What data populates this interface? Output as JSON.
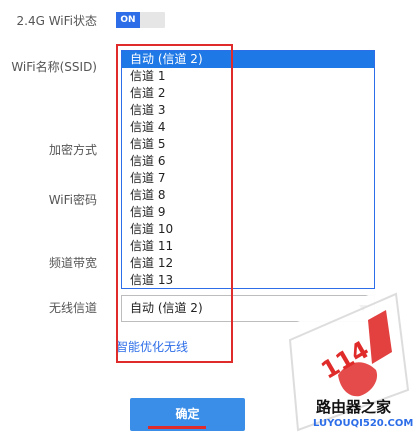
{
  "settings": {
    "wifi_status_label": "2.4G WiFi状态",
    "wifi_status_value": "ON",
    "ssid_label": "WiFi名称(SSID)",
    "encryption_label": "加密方式",
    "password_label": "WiFi密码",
    "bandwidth_label": "频道带宽",
    "channel_label": "无线信道"
  },
  "channel_dropdown": {
    "options": [
      "自动 (信道 2)",
      "信道 1",
      "信道 2",
      "信道 3",
      "信道 4",
      "信道 5",
      "信道 6",
      "信道 7",
      "信道 8",
      "信道 9",
      "信道 10",
      "信道 11",
      "信道 12",
      "信道 13"
    ],
    "selected_value": "自动 (信道 2)"
  },
  "link": {
    "smart_optimize": "智能优化无线"
  },
  "buttons": {
    "confirm": "确定"
  },
  "watermark": {
    "number": "114",
    "site_name": "路由器之家",
    "site_url": "LUYOUQI520.COM"
  },
  "colors": {
    "accent": "#2d6ee8",
    "highlight": "#e02b2b",
    "button": "#3a8ee8"
  }
}
